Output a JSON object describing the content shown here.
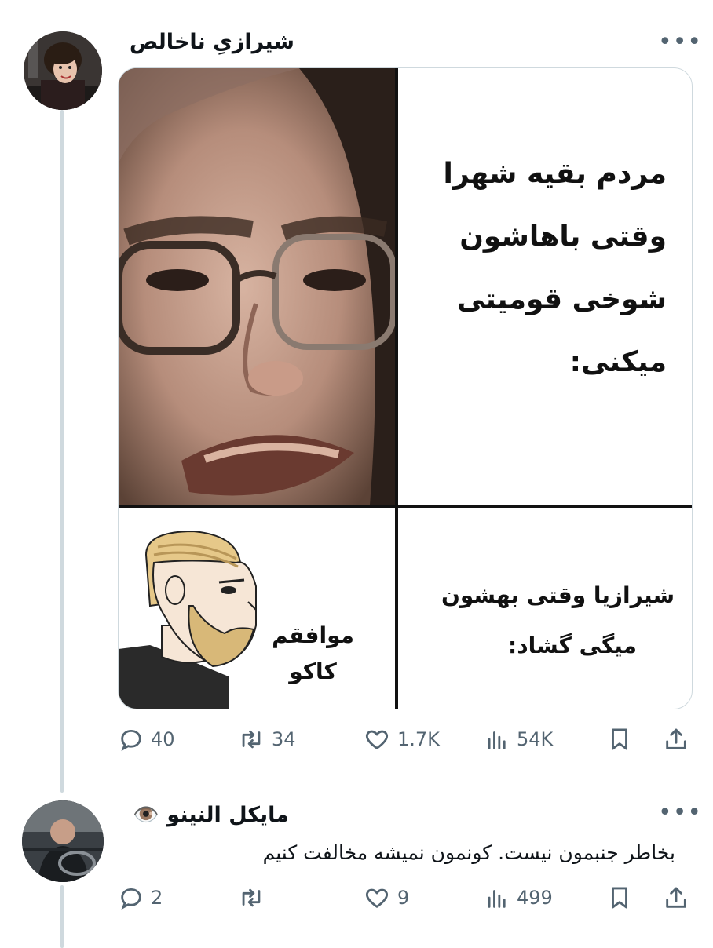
{
  "post": {
    "author_name": "شیرازیِ ناخالص",
    "more_label": "•••",
    "meme": {
      "top_right_text": [
        "مردم بقیه شهرا",
        "وقتی باهاشون",
        "شوخی قومیتی",
        "میکنی:"
      ],
      "bottom_right_text": [
        "شیرازیا وقتی بهشون",
        "میگی گشاد:"
      ],
      "bottom_left_text": [
        "موافقم",
        "کاکو"
      ]
    },
    "stats": {
      "replies": "40",
      "reposts": "34",
      "likes": "1.7K",
      "views": "54K"
    }
  },
  "reply": {
    "author_name": "مایکل النینو",
    "author_emoji": "👁️",
    "more_label": "•••",
    "text": "بخاطر جنبمون نیست. کونمون نمیشه مخالفت کنیم",
    "stats": {
      "replies": "2",
      "reposts": "",
      "likes": "9",
      "views": "499"
    }
  },
  "icons": [
    "reply-icon",
    "repost-icon",
    "like-icon",
    "views-icon",
    "bookmark-icon",
    "share-icon",
    "eye-emoji-icon"
  ],
  "colors": {
    "icon_gray": "#536471",
    "thread_line": "#cfd9de",
    "text": "#0f1419"
  }
}
